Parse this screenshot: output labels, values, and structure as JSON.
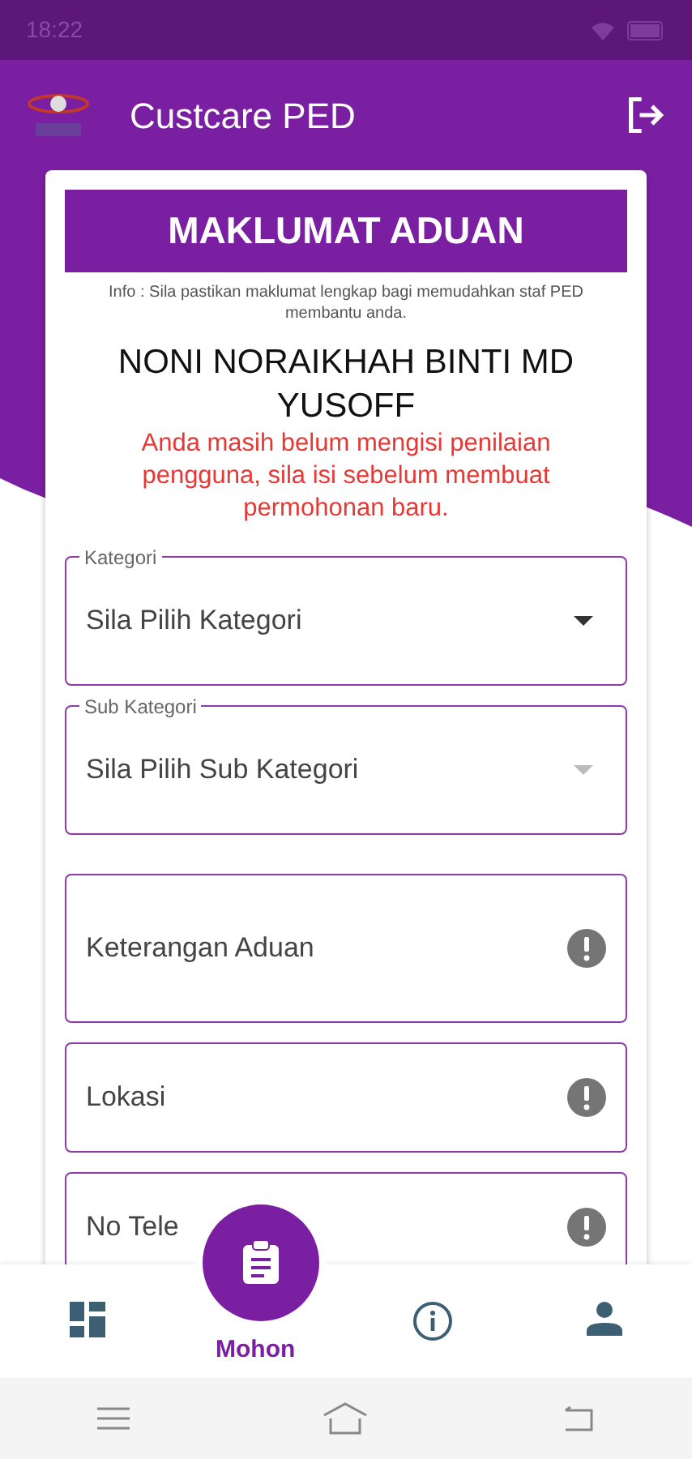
{
  "status_bar": {
    "time": "18:22"
  },
  "app_bar": {
    "title": "Custcare PED"
  },
  "card": {
    "header": "MAKLUMAT ADUAN",
    "info": "Info : Sila pastikan maklumat lengkap bagi memudahkan staf PED membantu anda.",
    "name": "NONI NORAIKHAH BINTI MD YUSOFF",
    "warning": "Anda masih belum mengisi penilaian pengguna, sila isi sebelum membuat permohonan baru.",
    "fields": [
      {
        "kind": "select",
        "label": "Kategori",
        "placeholder": "Sila Pilih Kategori",
        "disabled": false
      },
      {
        "kind": "select",
        "label": "Sub Kategori",
        "placeholder": "Sila Pilih Sub Kategori",
        "disabled": true
      },
      {
        "kind": "text",
        "placeholder": "Keterangan Aduan",
        "multiline": true
      },
      {
        "kind": "text",
        "placeholder": "Lokasi",
        "multiline": false
      },
      {
        "kind": "text",
        "placeholder": "No Tele",
        "multiline": false
      }
    ]
  },
  "bottom_nav": [
    {
      "kind": "dashboard",
      "selected": false
    },
    {
      "kind": "request",
      "label": "Mohon",
      "selected": true
    },
    {
      "kind": "info",
      "selected": false
    },
    {
      "kind": "profile",
      "selected": false
    }
  ]
}
